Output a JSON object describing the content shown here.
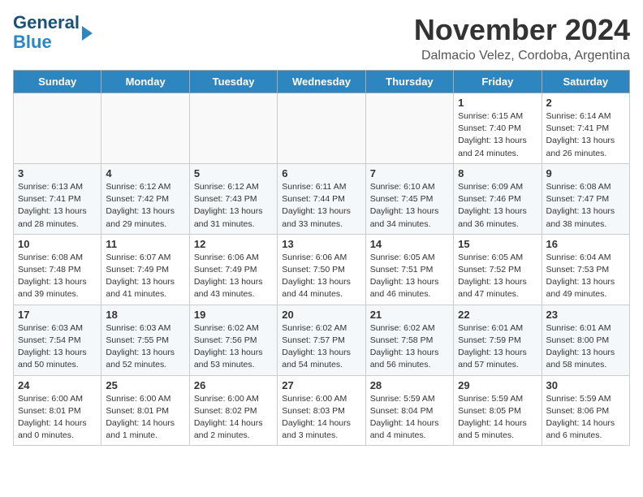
{
  "header": {
    "logo_line1": "General",
    "logo_line2": "Blue",
    "month": "November 2024",
    "location": "Dalmacio Velez, Cordoba, Argentina"
  },
  "weekdays": [
    "Sunday",
    "Monday",
    "Tuesday",
    "Wednesday",
    "Thursday",
    "Friday",
    "Saturday"
  ],
  "rows": [
    [
      {
        "day": "",
        "info": ""
      },
      {
        "day": "",
        "info": ""
      },
      {
        "day": "",
        "info": ""
      },
      {
        "day": "",
        "info": ""
      },
      {
        "day": "",
        "info": ""
      },
      {
        "day": "1",
        "info": "Sunrise: 6:15 AM\nSunset: 7:40 PM\nDaylight: 13 hours\nand 24 minutes."
      },
      {
        "day": "2",
        "info": "Sunrise: 6:14 AM\nSunset: 7:41 PM\nDaylight: 13 hours\nand 26 minutes."
      }
    ],
    [
      {
        "day": "3",
        "info": "Sunrise: 6:13 AM\nSunset: 7:41 PM\nDaylight: 13 hours\nand 28 minutes."
      },
      {
        "day": "4",
        "info": "Sunrise: 6:12 AM\nSunset: 7:42 PM\nDaylight: 13 hours\nand 29 minutes."
      },
      {
        "day": "5",
        "info": "Sunrise: 6:12 AM\nSunset: 7:43 PM\nDaylight: 13 hours\nand 31 minutes."
      },
      {
        "day": "6",
        "info": "Sunrise: 6:11 AM\nSunset: 7:44 PM\nDaylight: 13 hours\nand 33 minutes."
      },
      {
        "day": "7",
        "info": "Sunrise: 6:10 AM\nSunset: 7:45 PM\nDaylight: 13 hours\nand 34 minutes."
      },
      {
        "day": "8",
        "info": "Sunrise: 6:09 AM\nSunset: 7:46 PM\nDaylight: 13 hours\nand 36 minutes."
      },
      {
        "day": "9",
        "info": "Sunrise: 6:08 AM\nSunset: 7:47 PM\nDaylight: 13 hours\nand 38 minutes."
      }
    ],
    [
      {
        "day": "10",
        "info": "Sunrise: 6:08 AM\nSunset: 7:48 PM\nDaylight: 13 hours\nand 39 minutes."
      },
      {
        "day": "11",
        "info": "Sunrise: 6:07 AM\nSunset: 7:49 PM\nDaylight: 13 hours\nand 41 minutes."
      },
      {
        "day": "12",
        "info": "Sunrise: 6:06 AM\nSunset: 7:49 PM\nDaylight: 13 hours\nand 43 minutes."
      },
      {
        "day": "13",
        "info": "Sunrise: 6:06 AM\nSunset: 7:50 PM\nDaylight: 13 hours\nand 44 minutes."
      },
      {
        "day": "14",
        "info": "Sunrise: 6:05 AM\nSunset: 7:51 PM\nDaylight: 13 hours\nand 46 minutes."
      },
      {
        "day": "15",
        "info": "Sunrise: 6:05 AM\nSunset: 7:52 PM\nDaylight: 13 hours\nand 47 minutes."
      },
      {
        "day": "16",
        "info": "Sunrise: 6:04 AM\nSunset: 7:53 PM\nDaylight: 13 hours\nand 49 minutes."
      }
    ],
    [
      {
        "day": "17",
        "info": "Sunrise: 6:03 AM\nSunset: 7:54 PM\nDaylight: 13 hours\nand 50 minutes."
      },
      {
        "day": "18",
        "info": "Sunrise: 6:03 AM\nSunset: 7:55 PM\nDaylight: 13 hours\nand 52 minutes."
      },
      {
        "day": "19",
        "info": "Sunrise: 6:02 AM\nSunset: 7:56 PM\nDaylight: 13 hours\nand 53 minutes."
      },
      {
        "day": "20",
        "info": "Sunrise: 6:02 AM\nSunset: 7:57 PM\nDaylight: 13 hours\nand 54 minutes."
      },
      {
        "day": "21",
        "info": "Sunrise: 6:02 AM\nSunset: 7:58 PM\nDaylight: 13 hours\nand 56 minutes."
      },
      {
        "day": "22",
        "info": "Sunrise: 6:01 AM\nSunset: 7:59 PM\nDaylight: 13 hours\nand 57 minutes."
      },
      {
        "day": "23",
        "info": "Sunrise: 6:01 AM\nSunset: 8:00 PM\nDaylight: 13 hours\nand 58 minutes."
      }
    ],
    [
      {
        "day": "24",
        "info": "Sunrise: 6:00 AM\nSunset: 8:01 PM\nDaylight: 14 hours\nand 0 minutes."
      },
      {
        "day": "25",
        "info": "Sunrise: 6:00 AM\nSunset: 8:01 PM\nDaylight: 14 hours\nand 1 minute."
      },
      {
        "day": "26",
        "info": "Sunrise: 6:00 AM\nSunset: 8:02 PM\nDaylight: 14 hours\nand 2 minutes."
      },
      {
        "day": "27",
        "info": "Sunrise: 6:00 AM\nSunset: 8:03 PM\nDaylight: 14 hours\nand 3 minutes."
      },
      {
        "day": "28",
        "info": "Sunrise: 5:59 AM\nSunset: 8:04 PM\nDaylight: 14 hours\nand 4 minutes."
      },
      {
        "day": "29",
        "info": "Sunrise: 5:59 AM\nSunset: 8:05 PM\nDaylight: 14 hours\nand 5 minutes."
      },
      {
        "day": "30",
        "info": "Sunrise: 5:59 AM\nSunset: 8:06 PM\nDaylight: 14 hours\nand 6 minutes."
      }
    ]
  ]
}
